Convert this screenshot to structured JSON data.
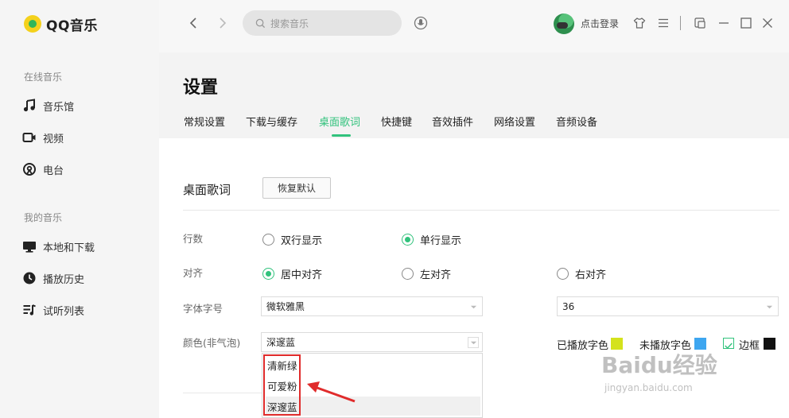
{
  "app": {
    "name": "QQ音乐"
  },
  "sidebar": {
    "sections": [
      {
        "title": "在线音乐",
        "items": [
          {
            "label": "音乐馆",
            "icon": "music-note-icon"
          },
          {
            "label": "视频",
            "icon": "video-icon"
          },
          {
            "label": "电台",
            "icon": "radio-icon"
          }
        ]
      },
      {
        "title": "我的音乐",
        "items": [
          {
            "label": "本地和下载",
            "icon": "monitor-icon"
          },
          {
            "label": "播放历史",
            "icon": "history-icon"
          },
          {
            "label": "试听列表",
            "icon": "playlist-icon"
          }
        ]
      }
    ]
  },
  "topbar": {
    "search_placeholder": "搜索音乐",
    "login_label": "点击登录",
    "icons": [
      "back-arrow-icon",
      "forward-arrow-icon",
      "search-icon",
      "mic-icon",
      "skin-shirt-icon",
      "menu-icon",
      "mini-mode-icon",
      "minimize-icon",
      "maximize-icon",
      "close-icon"
    ]
  },
  "settings": {
    "title": "设置",
    "tabs": [
      "常规设置",
      "下载与缓存",
      "桌面歌词",
      "快捷键",
      "音效插件",
      "网络设置",
      "音频设备"
    ],
    "active_tab": "桌面歌词",
    "section_title": "桌面歌词",
    "restore_button": "恢复默认",
    "rows": {
      "lines": {
        "label": "行数",
        "options": [
          "双行显示",
          "单行显示"
        ],
        "selected": "单行显示"
      },
      "align": {
        "label": "对齐",
        "options": [
          "居中对齐",
          "左对齐",
          "右对齐"
        ],
        "selected": "居中对齐"
      },
      "font": {
        "label": "字体字号",
        "font_value": "微软雅黑",
        "size_value": "36"
      },
      "color": {
        "label": "颜色(非气泡)",
        "value": "深邃蓝",
        "dropdown_options": [
          "清新绿",
          "可爱粉",
          "深邃蓝"
        ],
        "played_label": "已播放字色",
        "unplayed_label": "未播放字色",
        "border_label": "边框",
        "border_checked": true,
        "played_color": "#d4e21c",
        "unplayed_color": "#3ea6f0",
        "border_color": "#111111"
      }
    }
  },
  "watermark": {
    "logo": "Baidu经验",
    "url": "jingyan.baidu.com"
  },
  "colors": {
    "accent": "#31c27c",
    "annotation_red": "#e02b2b"
  }
}
